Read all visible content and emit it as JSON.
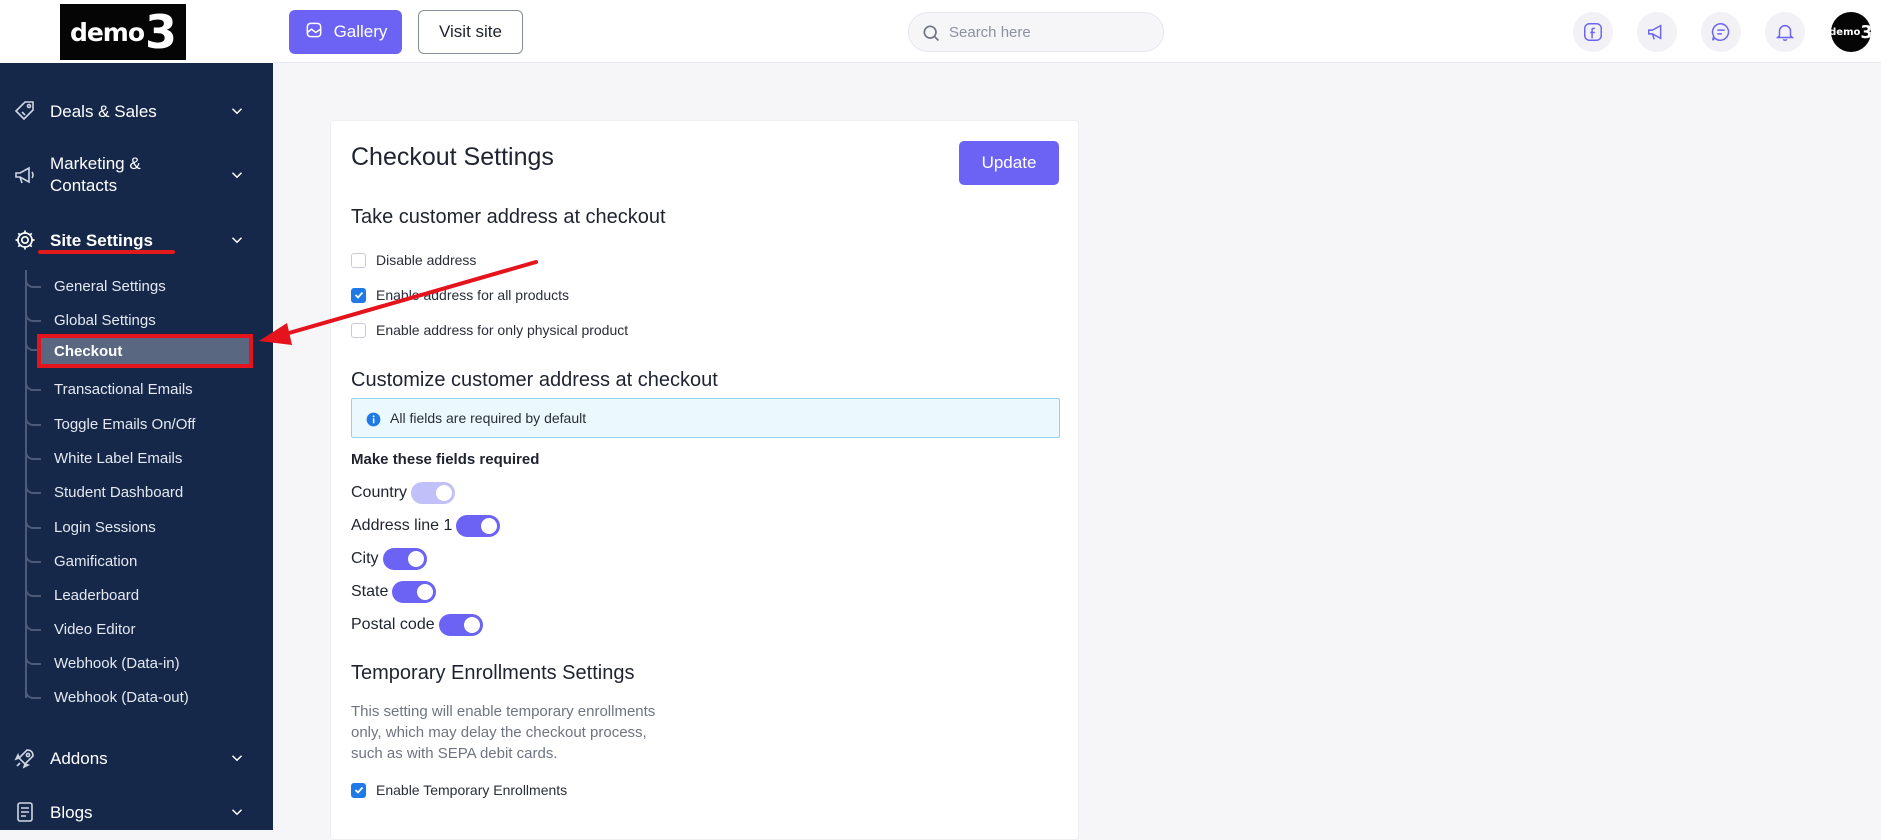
{
  "logo": {
    "text_small": "demo",
    "text_big": "3"
  },
  "sidebar": {
    "items": [
      {
        "label": "Deals & Sales",
        "icon": "tag-icon"
      },
      {
        "label": "Marketing &",
        "label2": "Contacts",
        "icon": "megaphone-icon"
      },
      {
        "label": "Site Settings",
        "icon": "gear-icon",
        "active": true
      },
      {
        "label": "Addons",
        "icon": "rocket-icon"
      },
      {
        "label": "Blogs",
        "icon": "document-icon"
      }
    ],
    "sub_items": [
      "General Settings",
      "Global Settings",
      "Checkout",
      "Transactional Emails",
      "Toggle Emails On/Off",
      "White Label Emails",
      "Student Dashboard",
      "Login Sessions",
      "Gamification",
      "Leaderboard",
      "Video Editor",
      "Webhook (Data-in)",
      "Webhook (Data-out)"
    ],
    "active_sub": "Checkout"
  },
  "header": {
    "gallery_label": "Gallery",
    "visit_label": "Visit site",
    "search_placeholder": "Search here",
    "avatar_small": "demo",
    "avatar_big": "3"
  },
  "page": {
    "title": "Checkout Settings",
    "update_label": "Update",
    "address_section": {
      "heading": "Take customer address at checkout",
      "options": [
        {
          "label": "Disable address",
          "checked": false
        },
        {
          "label": "Enable address for all products",
          "checked": true
        },
        {
          "label": "Enable address for only physical product",
          "checked": false
        }
      ]
    },
    "customize_section": {
      "heading": "Customize customer address at checkout",
      "info": "All fields are required by default",
      "required_heading": "Make these fields required",
      "fields": [
        {
          "label": "Country",
          "on": true,
          "disabled": true
        },
        {
          "label": "Address line 1",
          "on": true,
          "disabled": false
        },
        {
          "label": "City",
          "on": true,
          "disabled": false
        },
        {
          "label": "State",
          "on": true,
          "disabled": false
        },
        {
          "label": "Postal code",
          "on": true,
          "disabled": false
        }
      ]
    },
    "temporary_section": {
      "heading": "Temporary Enrollments Settings",
      "description_lines": [
        "This setting will enable temporary enrollments",
        "only, which may delay the checkout process,",
        "such as with SEPA debit cards."
      ],
      "checkbox_label": "Enable Temporary Enrollments",
      "checked": true
    }
  },
  "colors": {
    "accent": "#6c63f5",
    "sidebar_bg": "#16284a",
    "annotation_red": "#e5141c",
    "checkbox_blue": "#1f7ae8"
  }
}
